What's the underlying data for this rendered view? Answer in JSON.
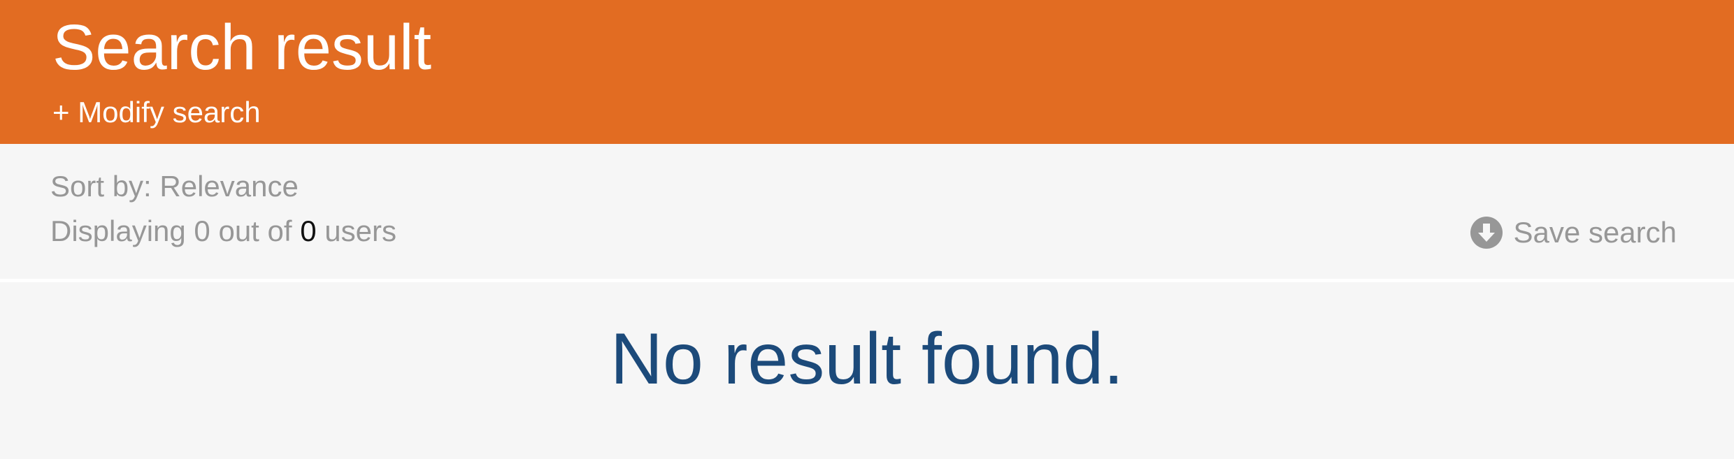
{
  "header": {
    "title": "Search result",
    "modify_link": "+ Modify search"
  },
  "toolbar": {
    "sort_by": "Sort by: Relevance",
    "displaying_prefix": "Displaying 0 out of ",
    "total_count": "0",
    "displaying_suffix": " users",
    "save_search_label": "Save search",
    "save_icon": "download-circle-icon"
  },
  "results": {
    "empty_message": "No result found."
  },
  "colors": {
    "header_bg": "#e26c22",
    "message_color": "#1c4a7a",
    "muted_text": "#979797"
  }
}
